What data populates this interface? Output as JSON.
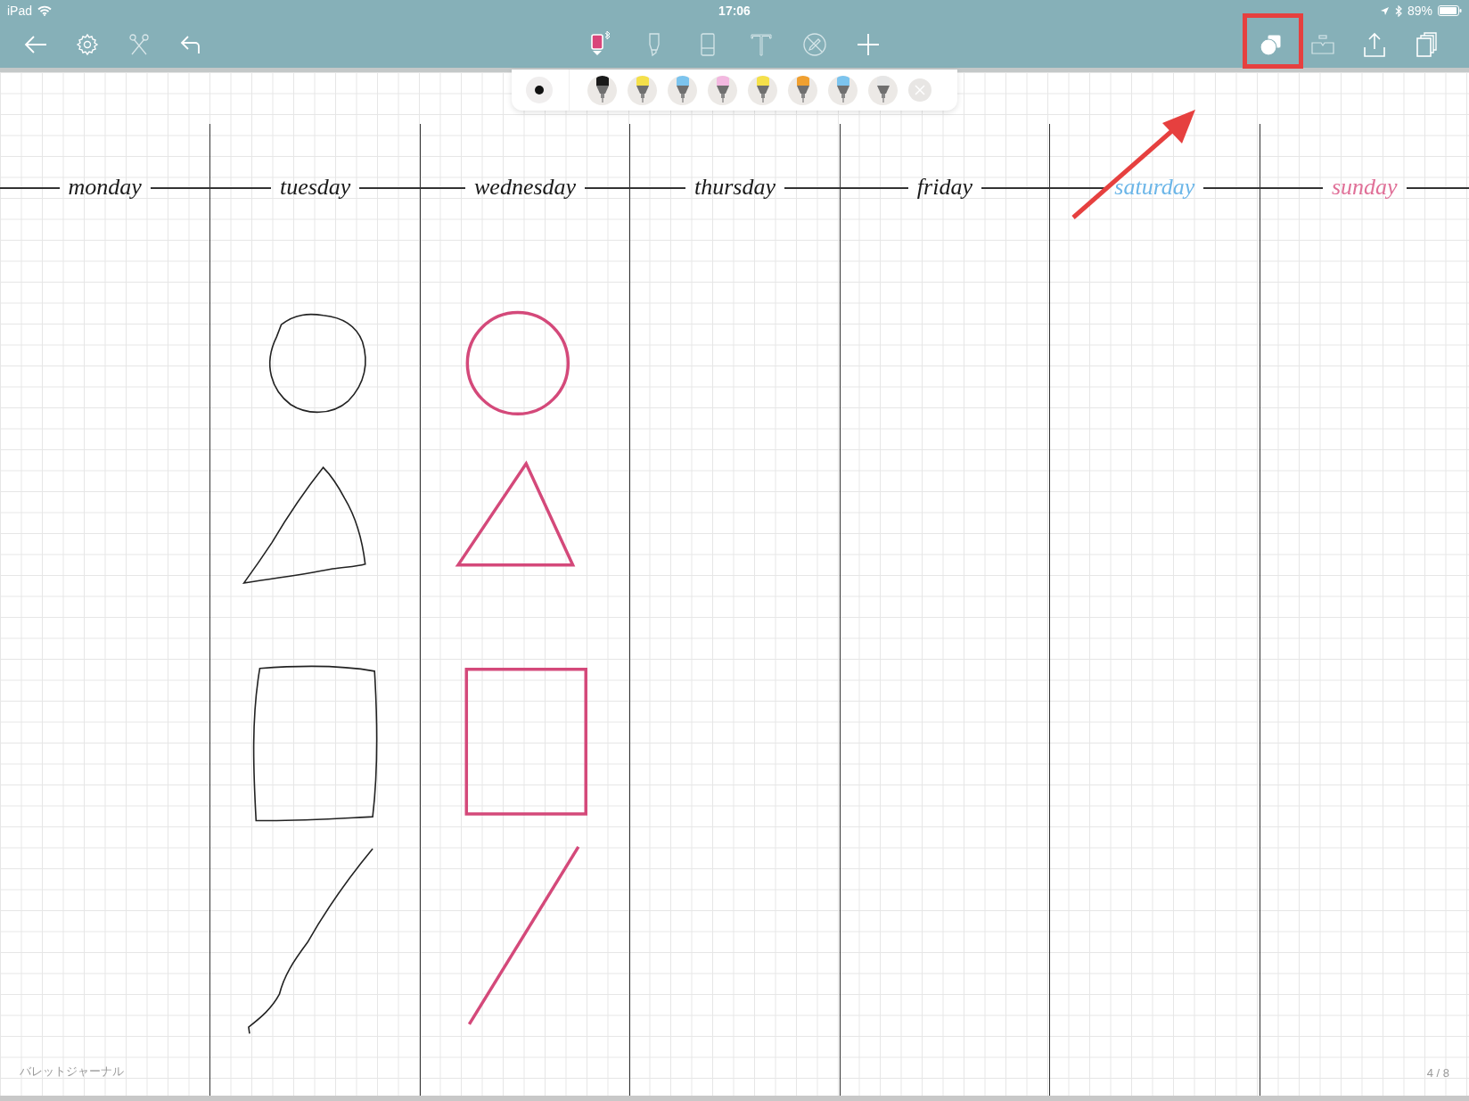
{
  "status_bar": {
    "device": "iPad",
    "time": "17:06",
    "battery": "89%"
  },
  "toolbar": {
    "left": [
      {
        "kind": "back"
      },
      {
        "kind": "settings"
      },
      {
        "kind": "scissors"
      },
      {
        "kind": "undo"
      }
    ],
    "tools": [
      {
        "kind": "pen",
        "selected": true
      },
      {
        "kind": "highlighter",
        "selected": false
      },
      {
        "kind": "eraser",
        "selected": false
      },
      {
        "kind": "text",
        "selected": false
      },
      {
        "kind": "lasso",
        "selected": false
      },
      {
        "kind": "add",
        "selected": false
      }
    ],
    "right": [
      {
        "kind": "shapes"
      },
      {
        "kind": "hand"
      },
      {
        "kind": "share"
      },
      {
        "kind": "pages"
      }
    ]
  },
  "pen_palette": {
    "pens": [
      {
        "color": "#1a1a1a"
      },
      {
        "color": "#f5e04a"
      },
      {
        "color": "#7cc4ee"
      },
      {
        "color": "#f3b8e0"
      },
      {
        "color": "#f5e04a"
      },
      {
        "color": "#f0a030"
      },
      {
        "color": "#7cc4ee"
      },
      {
        "color": "#e6e6e6"
      }
    ]
  },
  "days": [
    {
      "label": "monday",
      "color": "#1a1a1a"
    },
    {
      "label": "tuesday",
      "color": "#1a1a1a"
    },
    {
      "label": "wednesday",
      "color": "#1a1a1a"
    },
    {
      "label": "thursday",
      "color": "#1a1a1a"
    },
    {
      "label": "friday",
      "color": "#1a1a1a"
    },
    {
      "label": "saturday",
      "color": "#6cb6e8"
    },
    {
      "label": "sunday",
      "color": "#e07098"
    }
  ],
  "footer": {
    "notebook_title": "バレットジャーナル",
    "page": "4 / 8"
  }
}
